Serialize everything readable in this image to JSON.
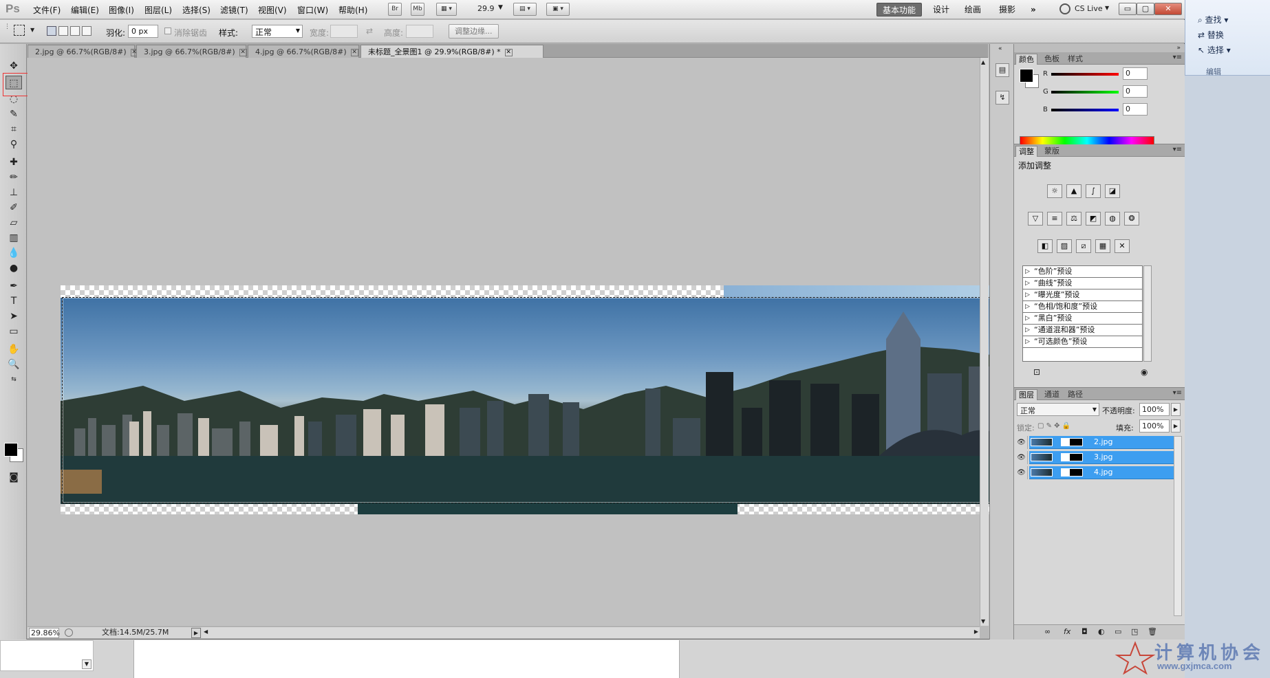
{
  "app": {
    "logo": "Ps",
    "menu": [
      "文件(F)",
      "编辑(E)",
      "图像(I)",
      "图层(L)",
      "选择(S)",
      "滤镜(T)",
      "视图(V)",
      "窗口(W)",
      "帮助(H)"
    ],
    "bridge_label": "Br",
    "minibridge_label": "Mb",
    "zoom_value": "29.9",
    "workspaces": [
      "基本功能",
      "设计",
      "绘画",
      "摄影"
    ],
    "more_workspaces": "»",
    "cs_live": "CS Live"
  },
  "options": {
    "feather_label": "羽化:",
    "feather_value": "0 px",
    "antialias_label": "消除锯齿",
    "style_label": "样式:",
    "style_value": "正常",
    "width_label": "宽度:",
    "height_label": "高度:",
    "refine_edge_label": "调整边缘..."
  },
  "tabs": [
    {
      "label": "2.jpg @ 66.7%(RGB/8#)"
    },
    {
      "label": "3.jpg @ 66.7%(RGB/8#)"
    },
    {
      "label": "4.jpg @ 66.7%(RGB/8#)"
    },
    {
      "label": "未标题_全景图1 @ 29.9%(RGB/8#) *"
    }
  ],
  "status": {
    "zoom": "29.86%",
    "doc_info": "文档:14.5M/25.7M"
  },
  "color_panel": {
    "tabs": [
      "颜色",
      "色板",
      "样式"
    ],
    "channels": [
      {
        "label": "R",
        "value": "0",
        "color": "#d00000"
      },
      {
        "label": "G",
        "value": "0",
        "color": "#00b000"
      },
      {
        "label": "B",
        "value": "0",
        "color": "#0000d0"
      }
    ]
  },
  "adjust_panel": {
    "tabs": [
      "调整",
      "蒙版"
    ],
    "title": "添加调整",
    "presets": [
      "“色阶”预设",
      "“曲线”预设",
      "“曝光度”预设",
      "“色相/饱和度”预设",
      "“黑白”预设",
      "“通道混和器”预设",
      "“可选颜色”预设"
    ]
  },
  "layers_panel": {
    "tabs": [
      "图层",
      "通道",
      "路径"
    ],
    "blend_mode": "正常",
    "opacity_label": "不透明度:",
    "opacity_value": "100%",
    "lock_label": "锁定:",
    "fill_label": "填充:",
    "fill_value": "100%",
    "layers": [
      {
        "name": "2.jpg"
      },
      {
        "name": "3.jpg"
      },
      {
        "name": "4.jpg"
      }
    ]
  },
  "background_app": {
    "ribbon_items": [
      "查找",
      "替换",
      "选择"
    ],
    "group_label": "编辑"
  },
  "watermark": {
    "text": "计算机协会",
    "url": "www.gxjmca.com"
  }
}
